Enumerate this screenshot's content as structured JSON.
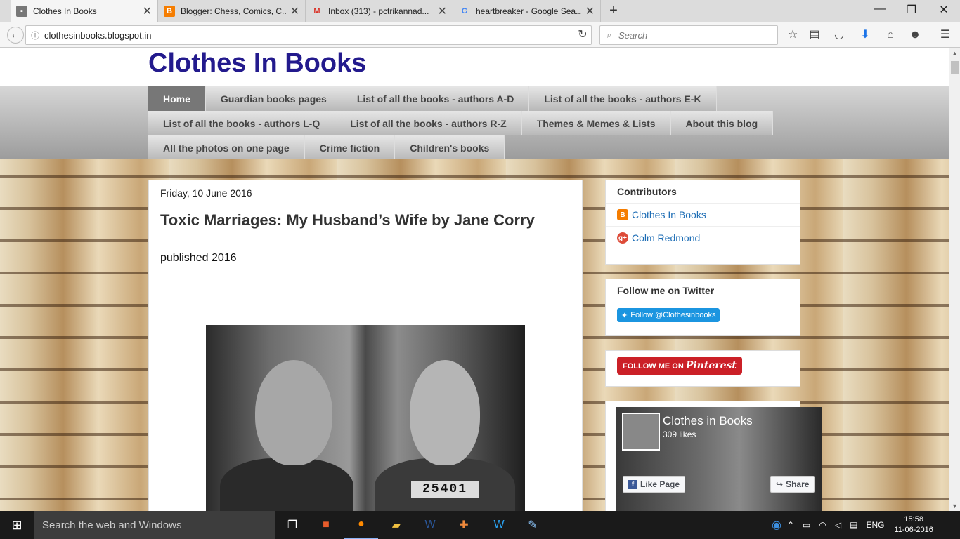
{
  "browser": {
    "tabs": [
      {
        "title": "Clothes In Books",
        "favicon": "page-icon",
        "active": true
      },
      {
        "title": "Blogger: Chess, Comics, C...",
        "favicon": "blogger-icon"
      },
      {
        "title": "Inbox (313) - pctrikannad...",
        "favicon": "gmail-icon"
      },
      {
        "title": "heartbreaker - Google Sea...",
        "favicon": "google-icon"
      }
    ],
    "url": "clothesinbooks.blogspot.in",
    "search_placeholder": "Search"
  },
  "blog": {
    "title": "Clothes In Books",
    "nav_rows": [
      [
        "Home",
        "Guardian books pages",
        "List of all the books - authors A-D",
        "List of all the books - authors E-K"
      ],
      [
        "List of all the books - authors L-Q",
        "List of all the books - authors R-Z",
        "Themes & Memes & Lists",
        "About this blog"
      ],
      [
        "All the photos on one page",
        "Crime fiction",
        "Children's books"
      ]
    ]
  },
  "post": {
    "date": "Friday, 10 June 2016",
    "title": "Toxic Marriages: My Husband’s Wife by Jane Corry",
    "body": "published 2016",
    "photo_plate": "25401"
  },
  "sidebar": {
    "contributors_title": "Contributors",
    "contributors": [
      "Clothes In Books",
      "Colm Redmond"
    ],
    "twitter_title": "Follow me on Twitter",
    "twitter_button": "Follow @Clothesinbooks",
    "pinterest_button": "FOLLOW ME ON",
    "pinterest_logo": "Pinterest",
    "facebook": {
      "name": "Clothes in Books",
      "likes": "309 likes",
      "like_button": "Like Page",
      "share_button": "Share"
    }
  },
  "taskbar": {
    "search_placeholder": "Search the web and Windows",
    "language": "ENG",
    "time": "15:58",
    "date": "11-06-2016"
  },
  "colors": {
    "blog_title": "#231a8d",
    "link": "#1d6db5",
    "pinterest": "#cb2027",
    "twitter": "#1b95e0"
  }
}
